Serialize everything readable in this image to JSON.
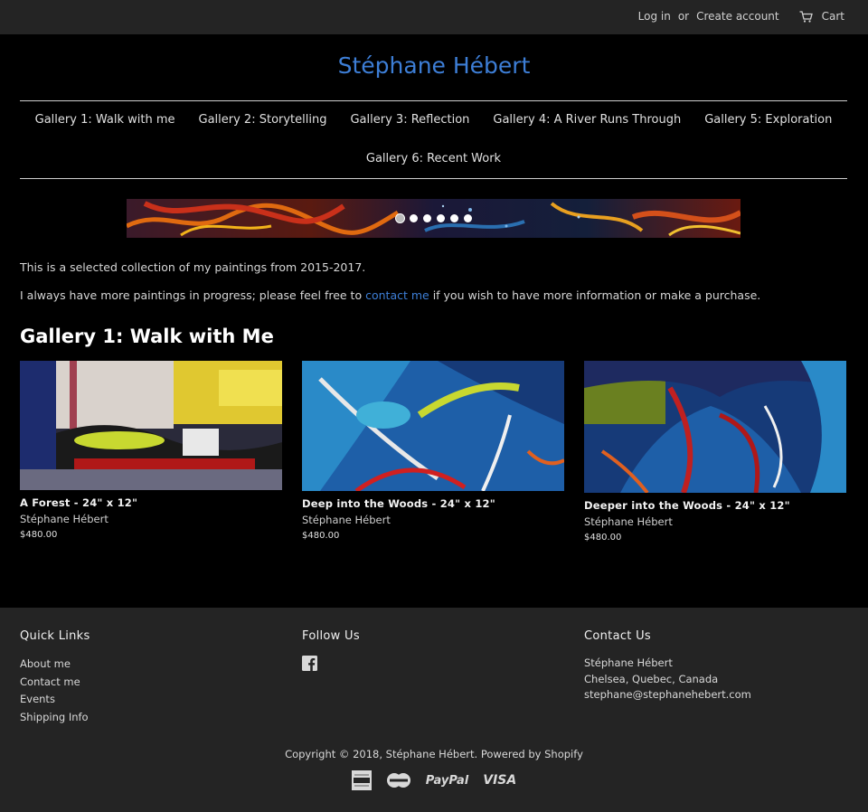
{
  "header": {
    "login": "Log in",
    "or": "or",
    "create_account": "Create account",
    "cart": "Cart",
    "cart_icon": "cart-icon"
  },
  "site": {
    "title": "Stéphane Hébert"
  },
  "nav": {
    "row1": [
      "Gallery 1: Walk with me",
      "Gallery 2: Storytelling",
      "Gallery 3: Reflection",
      "Gallery 4: A River Runs Through",
      "Gallery 5: Exploration"
    ],
    "row2": [
      "Gallery 6: Recent Work"
    ]
  },
  "slideshow": {
    "slide_count": 6,
    "active_index": 0
  },
  "intro": {
    "line1": "This is a selected collection of my paintings from 2015-2017.",
    "line2_before": "I always have more paintings in progress; please feel free to ",
    "line2_link": "contact me",
    "line2_after": " if you wish to have more information or make a purchase."
  },
  "gallery": {
    "title": "Gallery 1: Walk with Me",
    "products": [
      {
        "title": "A Forest - 24\" x 12\"",
        "vendor": "Stéphane Hébert",
        "price": "$480.00"
      },
      {
        "title": "Deep into the Woods - 24\" x 12\"",
        "vendor": "Stéphane Hébert",
        "price": "$480.00"
      },
      {
        "title": "Deeper into the Woods - 24\" x 12\"",
        "vendor": "Stéphane Hébert",
        "price": "$480.00"
      }
    ]
  },
  "footer": {
    "quick_links_title": "Quick Links",
    "quick_links": [
      "About me",
      "Contact me",
      "Events",
      "Shipping Info"
    ],
    "follow_title": "Follow Us",
    "follow_icon": "facebook-icon",
    "contact_title": "Contact Us",
    "contact_lines": [
      "Stéphane Hébert",
      "Chelsea, Quebec, Canada",
      "stephane@stephanehebert.com"
    ],
    "copyright": "Copyright © 2018, Stéphane Hébert. Powered by Shopify",
    "payment_icons": [
      "american-express-icon",
      "mastercard-icon",
      "paypal-icon",
      "visa-icon"
    ],
    "paypal_text": "PayPal",
    "visa_text": "VISA"
  },
  "colors": {
    "accent": "#3d7ed6",
    "footer_bg": "#242424",
    "page_bg": "#000000"
  }
}
